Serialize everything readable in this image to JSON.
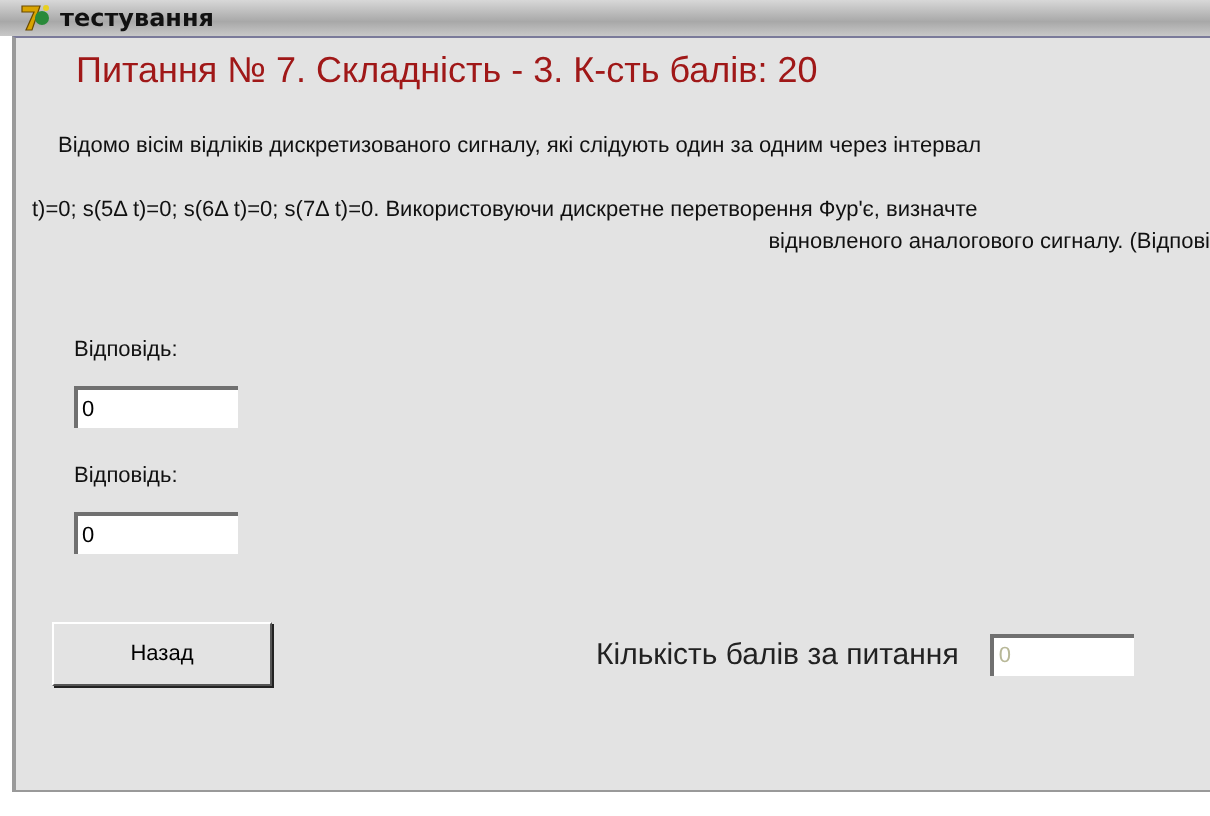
{
  "window": {
    "title": "тестування"
  },
  "question": {
    "heading": "Питання № 7. Складність - 3. К-сть балів: 20",
    "lines": [
      "Відомо вісім відліків дискретизованого сигналу, які слідують один за одним через інтервал",
      "t)=0; s(5Δ t)=0; s(6Δ t)=0; s(7Δ t)=0. Використовуючи дискретне перетворення Фур'є, визначте",
      "відновленого аналогового сигналу. (Відпові"
    ]
  },
  "answers": [
    {
      "label": "Відповідь:",
      "value": "0"
    },
    {
      "label": "Відповідь:",
      "value": "0"
    }
  ],
  "back_button": "Назад",
  "score": {
    "label": "Кількість балів за питання",
    "value": "0",
    "disabled": true
  }
}
